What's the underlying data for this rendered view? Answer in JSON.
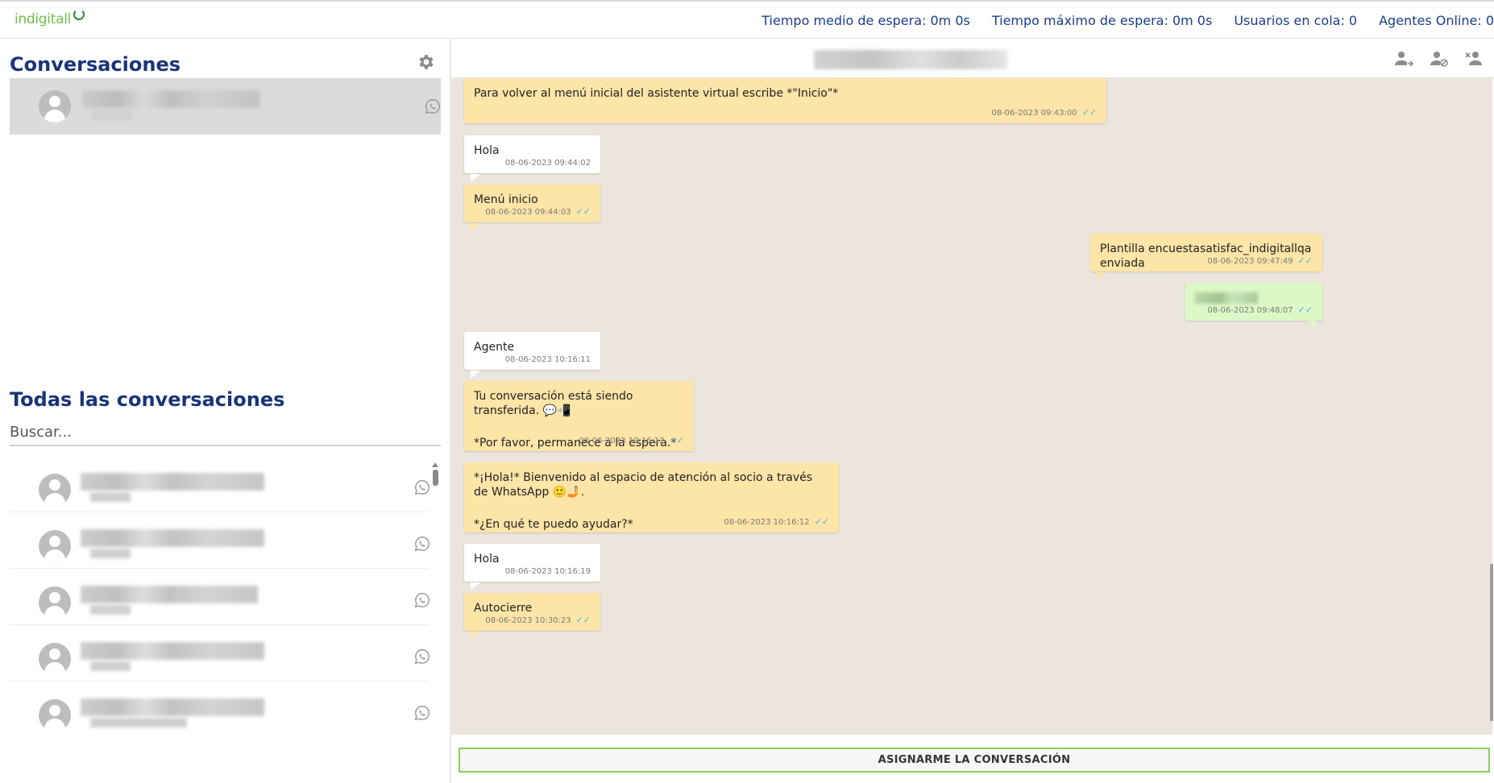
{
  "app": {
    "logo_text": "indigitall",
    "logo_icon": "refresh-arrow-icon",
    "brand_color": "#6cc04a"
  },
  "header": {
    "stats": [
      {
        "label": "Tiempo medio de espera: 0m 0s"
      },
      {
        "label": "Tiempo máximo de espera: 0m 0s"
      },
      {
        "label": "Usuarios en cola: 0"
      },
      {
        "label": "Agentes Online: 0"
      }
    ]
  },
  "sidebar": {
    "conversations_title": "Conversaciones",
    "settings_icon": "gear-icon",
    "all_title": "Todas las conversaciones",
    "search_placeholder": "Buscar...",
    "channel_icon": "whatsapp-icon"
  },
  "chat": {
    "header_icons": [
      "assign-user-icon",
      "block-user-icon",
      "remove-user-icon"
    ],
    "messages": [
      {
        "kind": "bot",
        "lines": [
          "Para volver al menú inicial del asistente virtual escribe *\"Inicio\"*"
        ],
        "time": "08-06-2023 09:43:00",
        "ticks": "✓✓"
      },
      {
        "kind": "user",
        "lines": [
          "Hola"
        ],
        "time": "08-06-2023 09:44:02",
        "ticks": ""
      },
      {
        "kind": "bot",
        "lines": [
          "Menú inicio"
        ],
        "time": "08-06-2023 09:44:03",
        "ticks": "✓✓"
      },
      {
        "kind": "bot",
        "lines": [
          "Plantilla encuestasatisfac_indigitallqa enviada"
        ],
        "time": "08-06-2023 09:47:49",
        "ticks": "✓✓"
      },
      {
        "kind": "agent",
        "lines": [
          ""
        ],
        "time": "08-06-2023 09:48:07",
        "ticks": "✓✓"
      },
      {
        "kind": "user",
        "lines": [
          "Agente"
        ],
        "time": "08-06-2023 10:16:11",
        "ticks": ""
      },
      {
        "kind": "bot",
        "lines": [
          "Tu conversación está siendo transferida. 💬📲",
          "*Por favor, permanece a la espera.*"
        ],
        "time": "08-06-2023 10:16:12",
        "ticks": "✓✓"
      },
      {
        "kind": "bot",
        "lines": [
          "*¡Hola!* Bienvenido al espacio de atención al socio a través de WhatsApp 🙂🤳.",
          "*¿En qué te puedo ayudar?*"
        ],
        "time": "08-06-2023 10:16:12",
        "ticks": "✓✓"
      },
      {
        "kind": "user",
        "lines": [
          "Hola"
        ],
        "time": "08-06-2023 10:16:19",
        "ticks": ""
      },
      {
        "kind": "bot",
        "lines": [
          "Autocierre"
        ],
        "time": "08-06-2023 10:30:23",
        "ticks": "✓✓"
      }
    ],
    "assign_button": "ASIGNARME LA CONVERSACIÓN"
  }
}
